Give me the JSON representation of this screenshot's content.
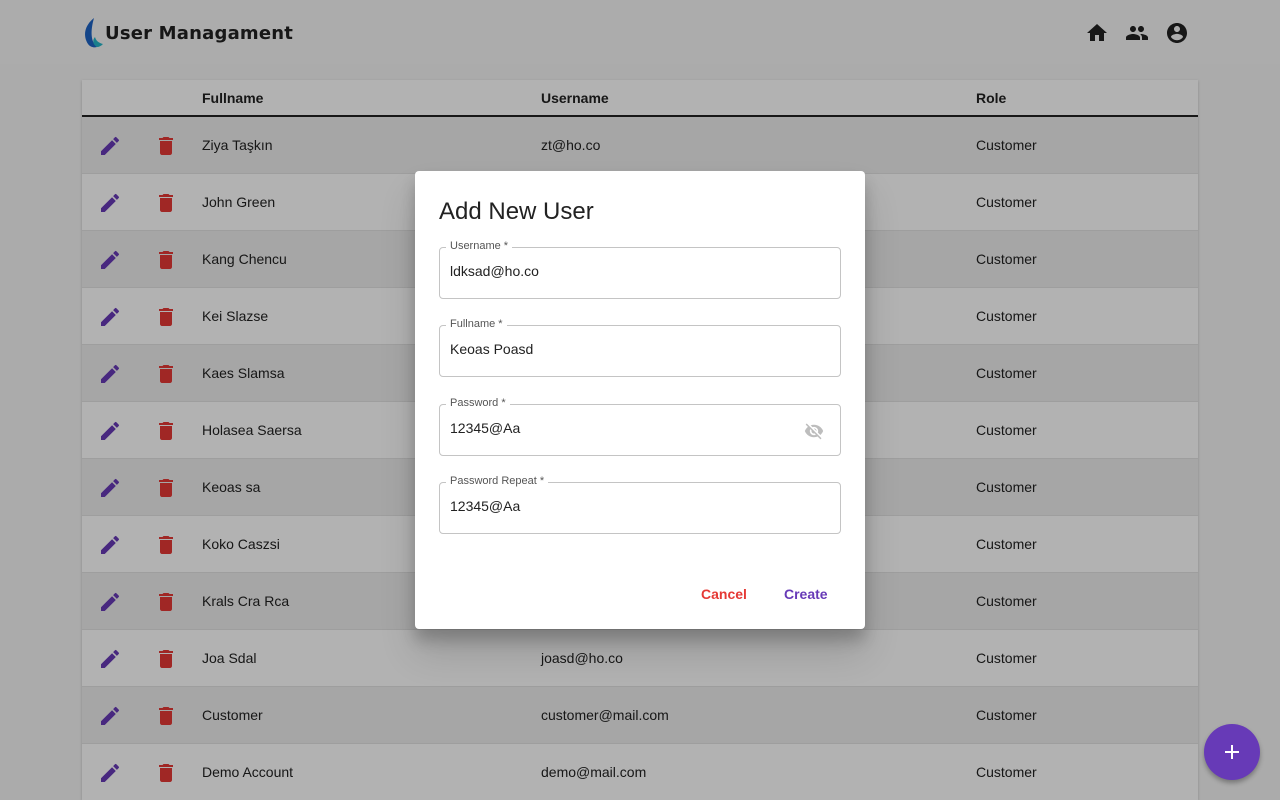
{
  "app": {
    "title": "User Managament"
  },
  "nav": {
    "icons": [
      "home-icon",
      "people-icon",
      "account-circle-icon"
    ]
  },
  "table": {
    "headers": {
      "fullname": "Fullname",
      "username": "Username",
      "role": "Role"
    },
    "rows": [
      {
        "fullname": "Ziya Taşkın",
        "username": "zt@ho.co",
        "role": "Customer"
      },
      {
        "fullname": "John Green",
        "username": "",
        "role": "Customer"
      },
      {
        "fullname": "Kang Chencu",
        "username": "",
        "role": "Customer"
      },
      {
        "fullname": "Kei Slazse",
        "username": "",
        "role": "Customer"
      },
      {
        "fullname": "Kaes Slamsa",
        "username": "",
        "role": "Customer"
      },
      {
        "fullname": "Holasea Saersa",
        "username": "",
        "role": "Customer"
      },
      {
        "fullname": "Keoas sa",
        "username": "",
        "role": "Customer"
      },
      {
        "fullname": "Koko Caszsi",
        "username": "",
        "role": "Customer"
      },
      {
        "fullname": "Krals Cra Rca",
        "username": "",
        "role": "Customer"
      },
      {
        "fullname": "Joa Sdal",
        "username": "joasd@ho.co",
        "role": "Customer"
      },
      {
        "fullname": "Customer",
        "username": "customer@mail.com",
        "role": "Customer"
      },
      {
        "fullname": "Demo Account",
        "username": "demo@mail.com",
        "role": "Customer"
      }
    ]
  },
  "dialog": {
    "title": "Add New User",
    "username_label": "Username *",
    "username_value": "ldksad@ho.co",
    "fullname_label": "Fullname *",
    "fullname_value": "Keoas Poasd",
    "password_label": "Password *",
    "password_value": "12345@Aa",
    "password_repeat_label": "Password Repeat *",
    "password_repeat_value": "12345@Aa",
    "cancel_label": "Cancel",
    "create_label": "Create"
  },
  "colors": {
    "primary": "#673ab7",
    "danger": "#e53935",
    "overlay": "rgba(0,0,0,0.30)"
  }
}
